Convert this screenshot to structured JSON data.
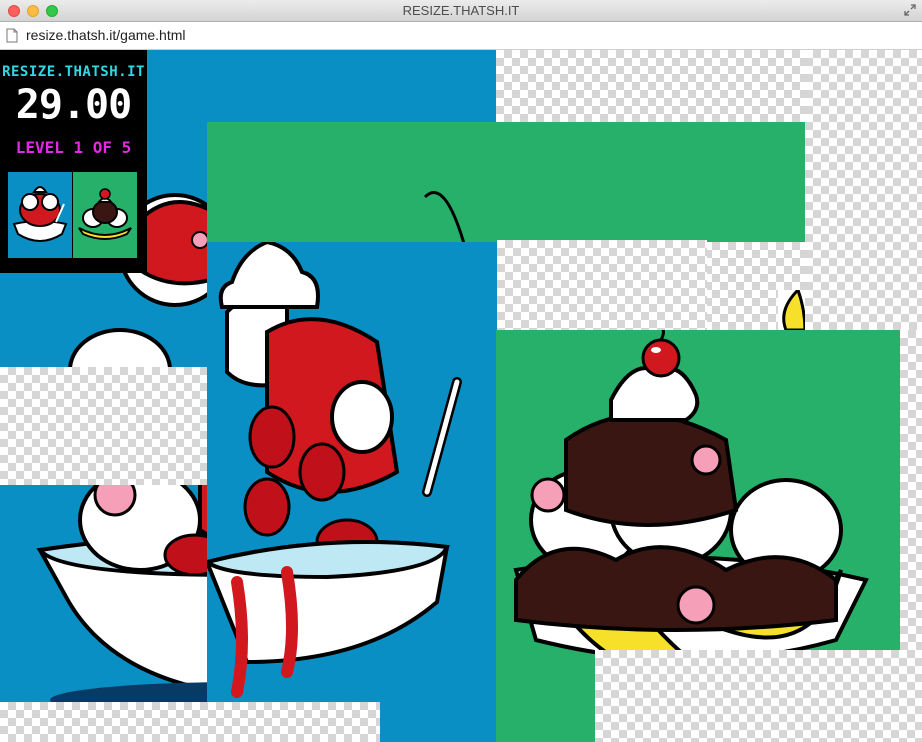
{
  "window": {
    "title": "RESIZE.THATSH.IT"
  },
  "address_bar": {
    "url": "resize.thatsh.it/game.html"
  },
  "hud": {
    "site": "RESIZE.THATSH.IT",
    "time": "29.00",
    "level": "LEVEL 1 OF 5",
    "thumbnails": [
      "strawberry-sundae-thumbnail",
      "banana-split-thumbnail"
    ]
  },
  "colors": {
    "blue_tile": "#0a8fc4",
    "green_tile": "#27b06a",
    "hud_cyan": "#2fd8e4",
    "hud_magenta": "#e428e4"
  }
}
